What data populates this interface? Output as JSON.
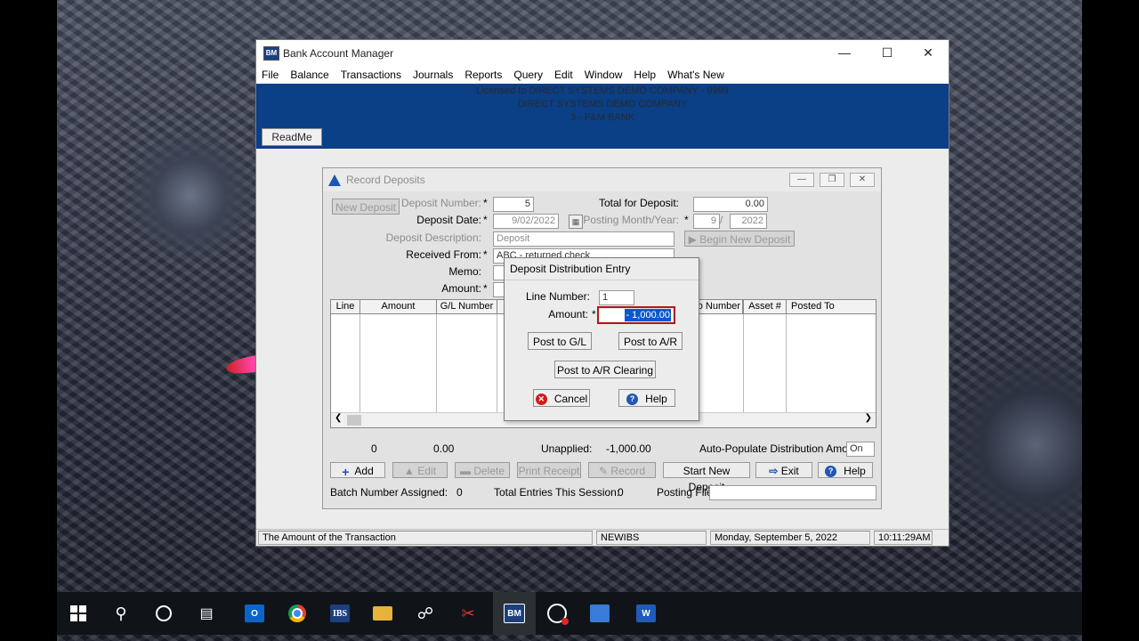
{
  "window": {
    "title": "Bank Account Manager",
    "icon_name": "bam-app-icon"
  },
  "menu": [
    "File",
    "Balance",
    "Transactions",
    "Journals",
    "Reports",
    "Query",
    "Edit",
    "Window",
    "Help",
    "What's New"
  ],
  "banner": {
    "line1": "Licensed to DIRECT SYSTEMS DEMO COMPANY - 9999",
    "line2": "DIRECT SYSTEMS DEMO COMPANY",
    "line3": "3 - F&M BANK",
    "readme_label": "ReadMe"
  },
  "record_deposits": {
    "title": "Record Deposits",
    "new_deposit_label": "New Deposit",
    "deposit_number_label": "Deposit Number:",
    "deposit_number": "5",
    "deposit_date_label": "Deposit Date:",
    "deposit_date": "9/02/2022",
    "deposit_description_label": "Deposit Description:",
    "deposit_description": "Deposit",
    "received_from_label": "Received From:",
    "received_from": "ABC - returned check",
    "memo_label": "Memo:",
    "amount_label": "Amount:",
    "total_for_deposit_label": "Total for Deposit:",
    "total_for_deposit": "0.00",
    "posting_month_year_label": "Posting Month/Year:",
    "posting_month": "9",
    "posting_year": "2022",
    "begin_new_deposit_label": "Begin New Deposit",
    "required_mark": "*",
    "grid_columns": [
      "Line",
      "Amount",
      "G/L Number",
      "o Number",
      "Asset #",
      "Posted To"
    ],
    "totals": {
      "count": "0",
      "amount": "0.00",
      "unapplied_label": "Unapplied:",
      "unapplied": "-1,000.00"
    },
    "auto_populate_label": "Auto-Populate Distribution Amount:",
    "auto_populate_value": "On",
    "buttons": {
      "add": "Add",
      "edit": "Edit",
      "delete": "Delete",
      "print_receipt": "Print Receipt",
      "record": "Record",
      "start_new_deposit": "Start New Deposit",
      "exit": "Exit",
      "help": "Help"
    },
    "batch_number_label": "Batch Number Assigned:",
    "batch_number": "0",
    "total_entries_label": "Total Entries This Session:",
    "total_entries": "0",
    "posting_file_label": "Posting File:",
    "posting_file": ""
  },
  "dialog": {
    "title": "Deposit Distribution Entry",
    "line_number_label": "Line Number:",
    "line_number": "1",
    "amount_label": "Amount:",
    "amount_value": "- 1,000.00",
    "post_gl": "Post to G/L",
    "post_ar": "Post to A/R",
    "post_ar_clearing": "Post to A/R Clearing",
    "cancel": "Cancel",
    "help": "Help"
  },
  "statusbar": {
    "message": "The Amount of the Transaction",
    "database": "NEWIBS",
    "date": "Monday, September  5, 2022",
    "time": "10:11:29AM"
  },
  "taskbar": {
    "items": [
      "windows-start-icon",
      "search-icon",
      "cortana-icon",
      "task-view-icon",
      "outlook-icon",
      "chrome-icon",
      "ibs-icon",
      "file-explorer-icon",
      "headset-icon",
      "snip-icon",
      "bam-icon",
      "record-icon",
      "remote-desktop-icon",
      "word-icon"
    ],
    "ibs_label": "IBS",
    "bam_label": "BM"
  }
}
